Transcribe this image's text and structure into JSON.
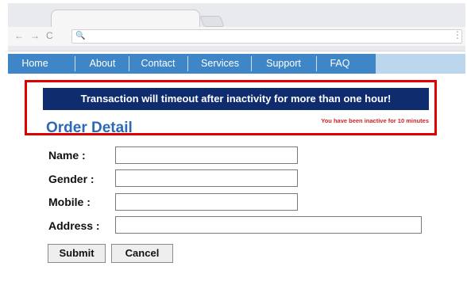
{
  "browser": {
    "back_glyph": "←",
    "forward_glyph": "→",
    "reload_glyph": "C",
    "search_glyph": "🔍",
    "menu_glyph": "⋮"
  },
  "nav": {
    "items": [
      "Home",
      "About",
      "Contact",
      "Services",
      "Support",
      "FAQ"
    ],
    "bar_color": "#3f86c8"
  },
  "alert": {
    "message": "Transaction will timeout after inactivity for more than one hour!",
    "inactive_note": "You have been inactive for 10 minutes",
    "banner_color": "#0f2c6e",
    "highlight_color": "#e00000"
  },
  "form": {
    "title": "Order Detail",
    "name_label": "Name :",
    "gender_label": "Gender :",
    "mobile_label": "Mobile :",
    "address_label": "Address :",
    "name_value": "",
    "gender_value": "",
    "mobile_value": "",
    "address_value": "",
    "submit_label": "Submit",
    "cancel_label": "Cancel"
  }
}
